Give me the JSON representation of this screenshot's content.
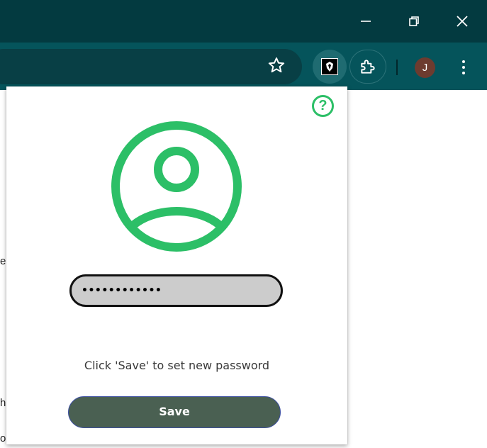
{
  "browser": {
    "window_controls": {
      "minimize_icon": "minimize-icon",
      "restore_icon": "restore-icon",
      "close_icon": "close-icon"
    },
    "toolbar": {
      "bookmark_icon": "star-icon",
      "extension_icon": "extension-logo-icon",
      "extensions_icon": "puzzle-icon",
      "profile_initial": "J",
      "profile_color": "#6d3b2f",
      "menu_icon": "more-vertical-icon"
    },
    "colors": {
      "titlebar": "#033a40",
      "toolbar": "#05545b"
    }
  },
  "page": {
    "edge_fragments": [
      "e",
      "h",
      "o"
    ]
  },
  "popup": {
    "help_label": "?",
    "user_icon": "user-circle-icon",
    "accent_color": "#2cbf67",
    "password": {
      "value": "••••••••••••"
    },
    "instruction": "Click 'Save' to set new password",
    "save_label": "Save",
    "save_color": "#4a6052"
  }
}
